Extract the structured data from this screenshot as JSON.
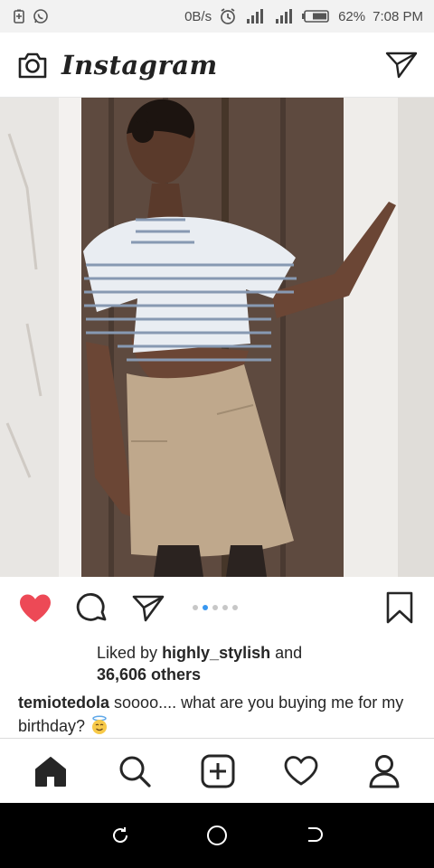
{
  "status_bar": {
    "speed": "0B/s",
    "battery": "62%",
    "time": "7:08 PM"
  },
  "header": {
    "app_name": "Instagram",
    "icons": [
      "camera-icon",
      "direct-message-icon"
    ]
  },
  "post": {
    "carousel": {
      "count": 5,
      "active_index": 1
    },
    "liked_by_prefix": "Liked by",
    "liked_by_user": "highly_stylish",
    "liked_by_and": "and",
    "likes_others": "36,606 others",
    "username": "temiotedola",
    "caption_text": "soooo.... what are you buying me for my birthday?",
    "caption_emoji": "smiling-face-with-halo",
    "liked": true,
    "colors": {
      "heart": "#ed4956",
      "dot_active": "#3897f0"
    }
  },
  "tab_bar": {
    "items": [
      "home-icon",
      "search-icon",
      "new-post-icon",
      "activity-icon",
      "profile-icon"
    ]
  },
  "system_nav": {
    "items": [
      "recent-apps-icon",
      "home-circle-icon",
      "back-icon"
    ]
  }
}
